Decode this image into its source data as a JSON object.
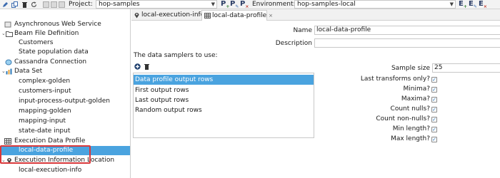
{
  "toolbar": {
    "project_label": "Project:",
    "project_value": "hop-samples",
    "pipeline_glyphs": [
      "P",
      "P",
      "P"
    ],
    "environment_label": "Environment:",
    "environment_value": "hop-samples-local",
    "env_glyphs": [
      "E",
      "E",
      "E"
    ]
  },
  "tree": {
    "items": [
      {
        "label": "Asynchronous Web Service"
      },
      {
        "label": "Beam File Definition"
      },
      {
        "label": "Customers"
      },
      {
        "label": "State population data"
      },
      {
        "label": "Cassandra Connection"
      },
      {
        "label": "Data Set"
      },
      {
        "label": "complex-golden"
      },
      {
        "label": "customers-input"
      },
      {
        "label": "input-process-output-golden"
      },
      {
        "label": "mapping-golden"
      },
      {
        "label": "mapping-input"
      },
      {
        "label": "state-date input"
      },
      {
        "label": "Execution Data Profile"
      },
      {
        "label": "local-data-profile"
      },
      {
        "label": "Execution Information Location"
      },
      {
        "label": "local-execution-info"
      }
    ]
  },
  "tabs": [
    {
      "label": "local-execution-info"
    },
    {
      "label": "local-data-profile",
      "close": "×"
    }
  ],
  "form": {
    "name_label": "Name",
    "name_value": "local-data-profile",
    "description_label": "Description",
    "description_value": "",
    "samplers_heading": "The data samplers to use:",
    "samplers": [
      {
        "label": "Data profile output rows"
      },
      {
        "label": "First output rows"
      },
      {
        "label": "Last output rows"
      },
      {
        "label": "Random output rows"
      }
    ],
    "sample_size_label": "Sample size",
    "sample_size_value": "25",
    "options": [
      {
        "label": "Last transforms only?",
        "checked": true
      },
      {
        "label": "Minima?",
        "checked": true
      },
      {
        "label": "Maxima?",
        "checked": true
      },
      {
        "label": "Count nulls?",
        "checked": true
      },
      {
        "label": "Count non-nulls?",
        "checked": true
      },
      {
        "label": "Min length?",
        "checked": true
      },
      {
        "label": "Max length?",
        "checked": true
      }
    ],
    "check_mark": "✓"
  },
  "colors": {
    "selection": "#4aa3df",
    "highlight_border": "#d9383a"
  }
}
